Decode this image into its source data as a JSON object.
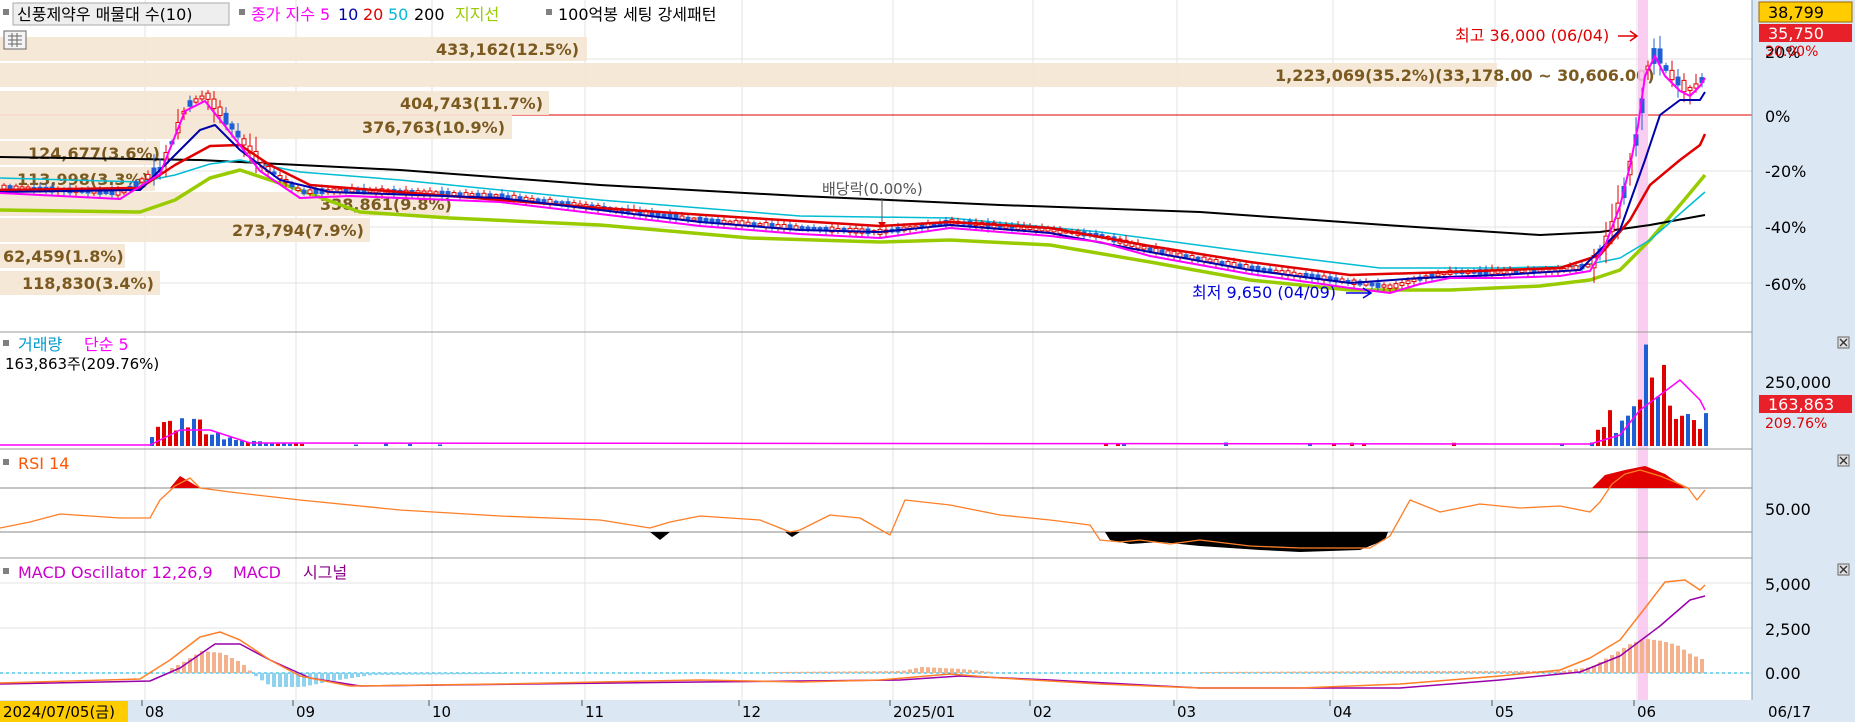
{
  "header": {
    "stock_title": "신풍제약우 매물대 수(10)",
    "ma_label": "종가 지수",
    "ma_periods": [
      "5",
      "10",
      "20",
      "50",
      "200"
    ],
    "support_label": "지지선",
    "pattern_label": "100억봉 세팅 강세패턴"
  },
  "panels": {
    "volume": {
      "title": "거래량",
      "ma_label": "단순 5",
      "info": "163,863주(209.76%)"
    },
    "rsi": {
      "title": "RSI 14"
    },
    "macd": {
      "title": "MACD Oscillator 12,26,9",
      "macd_label": "MACD",
      "signal_label": "시그널"
    }
  },
  "annotations": {
    "high": "최고 36,000 (06/04)",
    "low": "최저 9,650 (04/09)",
    "dividend": "배당락(0.00%)"
  },
  "colors": {
    "ma5": "#ff00ff",
    "ma10": "#0000aa",
    "ma20": "#e00000",
    "ma50": "#00bcd4",
    "ma200": "#000000",
    "support": "#99cc00",
    "up": "#e00000",
    "down": "#1f5fd6",
    "vp_bar": "#f5e6d3",
    "rsi_line": "#ff7f27",
    "macd_line": "#ff7f27",
    "signal_line": "#9900aa",
    "price_box": "#ffcc00"
  },
  "chart_data": [
    {
      "type": "candlestick",
      "name": "price",
      "x_axis": {
        "first_date": "2024/07/05(금)",
        "last_date": "06/17",
        "tick_labels": [
          "08",
          "09",
          "10",
          "11",
          "12",
          "2025/01",
          "02",
          "03",
          "04",
          "05",
          "06"
        ]
      },
      "y_axis_percent_ticks": [
        "20%",
        "0%",
        "-20%",
        "-40%",
        "-60%"
      ],
      "current_price_boxes": [
        "38,799",
        "35,750",
        "30.00%"
      ],
      "reference_line_percent": 0,
      "volume_profile": [
        {
          "label": "433,162(12.5%)"
        },
        {
          "label": "1,223,069(35.2%)(33,178.00 ~ 30,606.00)"
        },
        {
          "label": "404,743(11.7%)"
        },
        {
          "label": "376,763(10.9%)"
        },
        {
          "label": "124,677(3.6%)"
        },
        {
          "label": "113,998(3.3%)"
        },
        {
          "label": "338,861(9.8%)"
        },
        {
          "label": "273,794(7.9%)"
        },
        {
          "label": "62,459(1.8%)"
        },
        {
          "label": "118,830(3.4%)"
        }
      ],
      "high": 36000,
      "low": 9650
    },
    {
      "type": "bar",
      "name": "volume",
      "y_axis_ticks": [
        "250,000"
      ],
      "current_value_box": "163,863",
      "current_ratio": "209.76%"
    },
    {
      "type": "line",
      "name": "RSI 14",
      "y_axis_ticks": [
        "50.00"
      ],
      "ylim": [
        0,
        100
      ],
      "guides": [
        70,
        30
      ]
    },
    {
      "type": "line",
      "name": "MACD Oscillator 12,26,9",
      "y_axis_ticks": [
        "5,000",
        "2,500",
        "0.00"
      ]
    }
  ]
}
